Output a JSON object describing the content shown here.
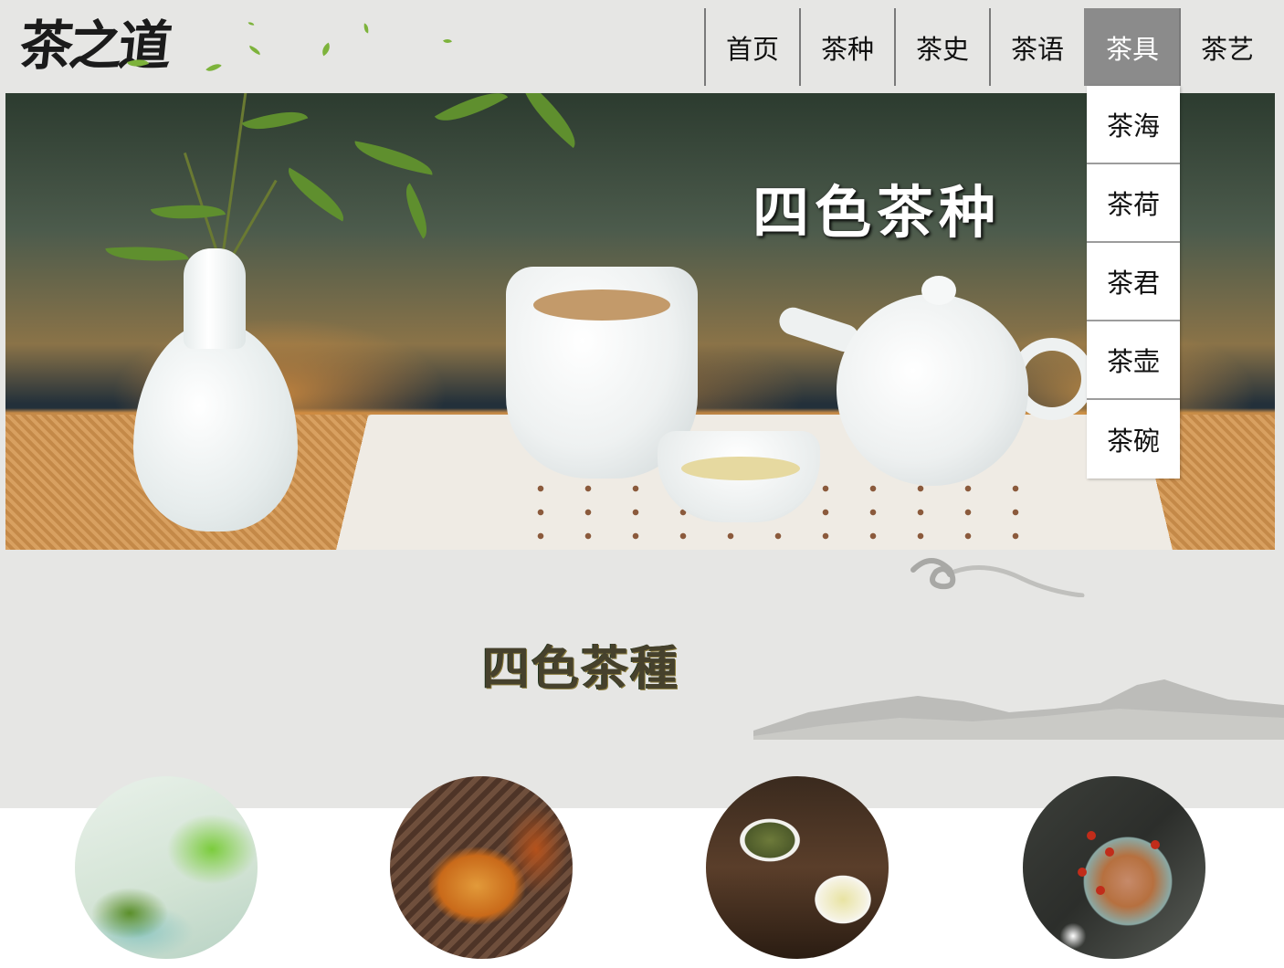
{
  "header": {
    "logo_text": "茶之道",
    "nav": [
      {
        "label": "首页",
        "active": false
      },
      {
        "label": "茶种",
        "active": false
      },
      {
        "label": "茶史",
        "active": false
      },
      {
        "label": "茶语",
        "active": false
      },
      {
        "label": "茶具",
        "active": true
      },
      {
        "label": "茶艺",
        "active": false
      }
    ]
  },
  "dropdown": {
    "items": [
      "茶海",
      "茶荷",
      "茶君",
      "茶壶",
      "茶碗"
    ]
  },
  "hero": {
    "title": "四色茶种"
  },
  "section": {
    "title": "四色茶種"
  },
  "colors": {
    "accent_nav_active": "#8b8b8b",
    "page_background": "#e6e6e4",
    "leaf_green": "#7db33b"
  }
}
